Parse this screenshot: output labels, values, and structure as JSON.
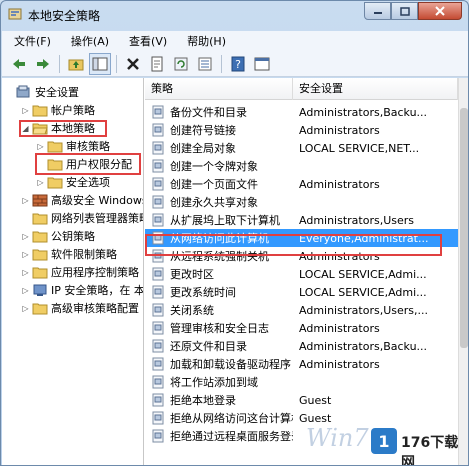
{
  "window": {
    "title": "本地安全策略"
  },
  "menu": [
    "文件(F)",
    "操作(A)",
    "查看(V)",
    "帮助(H)"
  ],
  "toolbar": [
    "back-arrow-icon",
    "forward-arrow-icon",
    "up-folder-icon",
    "show-tree-icon",
    "delete-icon",
    "properties-icon",
    "refresh-icon",
    "export-list-icon",
    "help-icon",
    "console-icon"
  ],
  "tree": [
    {
      "label": "安全设置",
      "level": 0,
      "expander": "",
      "icon": "security-settings-icon"
    },
    {
      "label": "帐户策略",
      "level": 1,
      "expander": "▷",
      "icon": "folder-icon"
    },
    {
      "label": "本地策略",
      "level": 1,
      "expander": "◢",
      "icon": "folder-open-icon"
    },
    {
      "label": "审核策略",
      "level": 2,
      "expander": "▷",
      "icon": "folder-icon"
    },
    {
      "label": "用户权限分配",
      "level": 2,
      "expander": "",
      "icon": "folder-icon"
    },
    {
      "label": "安全选项",
      "level": 2,
      "expander": "▷",
      "icon": "folder-icon"
    },
    {
      "label": "高级安全 Windows",
      "level": 1,
      "expander": "▷",
      "icon": "firewall-icon"
    },
    {
      "label": "网络列表管理器策略",
      "level": 1,
      "expander": "",
      "icon": "folder-icon"
    },
    {
      "label": "公钥策略",
      "level": 1,
      "expander": "▷",
      "icon": "folder-icon"
    },
    {
      "label": "软件限制策略",
      "level": 1,
      "expander": "▷",
      "icon": "folder-icon"
    },
    {
      "label": "应用程序控制策略",
      "level": 1,
      "expander": "▷",
      "icon": "folder-icon"
    },
    {
      "label": "IP 安全策略，在 本",
      "level": 1,
      "expander": "▷",
      "icon": "ip-security-icon"
    },
    {
      "label": "高级审核策略配置",
      "level": 1,
      "expander": "▷",
      "icon": "folder-icon"
    }
  ],
  "list": {
    "headers": [
      "策略",
      "安全设置"
    ],
    "rows": [
      {
        "policy": "备份文件和目录",
        "setting": "Administrators,Backu..."
      },
      {
        "policy": "创建符号链接",
        "setting": "Administrators"
      },
      {
        "policy": "创建全局对象",
        "setting": "LOCAL SERVICE,NET..."
      },
      {
        "policy": "创建一个令牌对象",
        "setting": ""
      },
      {
        "policy": "创建一个页面文件",
        "setting": "Administrators"
      },
      {
        "policy": "创建永久共享对象",
        "setting": ""
      },
      {
        "policy": "从扩展坞上取下计算机",
        "setting": "Administrators,Users"
      },
      {
        "policy": "从网络访问此计算机",
        "setting": "Everyone,Administrat...",
        "selected": true
      },
      {
        "policy": "从远程系统强制关机",
        "setting": "Administrators"
      },
      {
        "policy": "更改时区",
        "setting": "LOCAL SERVICE,Admi..."
      },
      {
        "policy": "更改系统时间",
        "setting": "LOCAL SERVICE,Admi..."
      },
      {
        "policy": "关闭系统",
        "setting": "Administrators,Users,..."
      },
      {
        "policy": "管理审核和安全日志",
        "setting": "Administrators"
      },
      {
        "policy": "还原文件和目录",
        "setting": "Administrators,Backu..."
      },
      {
        "policy": "加载和卸载设备驱动程序",
        "setting": "Administrators"
      },
      {
        "policy": "将工作站添加到域",
        "setting": ""
      },
      {
        "policy": "拒绝本地登录",
        "setting": "Guest"
      },
      {
        "policy": "拒绝从网络访问这台计算机",
        "setting": "Guest"
      },
      {
        "policy": "拒绝通过远程桌面服务登录",
        "setting": ""
      }
    ]
  },
  "watermark": {
    "script": "Win7",
    "brand": "176下载网"
  },
  "colors": {
    "selection": "#3399ff",
    "highlight": "#e04040"
  }
}
